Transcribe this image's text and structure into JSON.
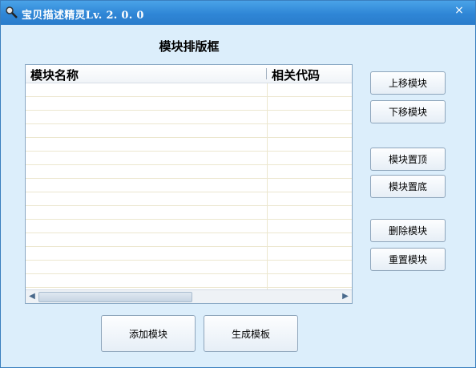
{
  "window": {
    "title": "宝贝描述精灵Lv. 2. 0. 0",
    "close_symbol": "×"
  },
  "panel": {
    "title": "模块排版框"
  },
  "list": {
    "columns": [
      "模块名称",
      "相关代码"
    ],
    "rows": []
  },
  "side_buttons": {
    "move_up": "上移模块",
    "move_down": "下移模块",
    "move_top": "模块置顶",
    "move_bottom": "模块置底",
    "delete": "删除模块",
    "reset": "重置模块"
  },
  "bottom_buttons": {
    "add": "添加模块",
    "generate": "生成模板"
  },
  "colors": {
    "titlebar": "#2f86d6",
    "background": "#dceefb",
    "row_line": "#ece7cf"
  }
}
